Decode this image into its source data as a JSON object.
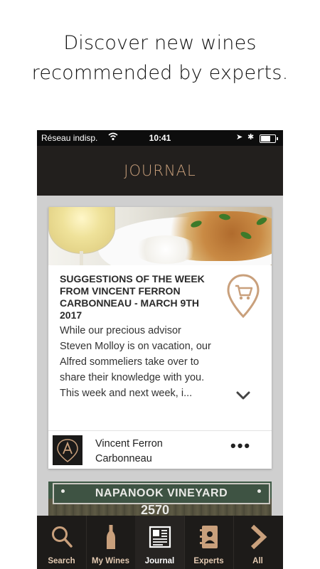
{
  "headline": "Discover new wines recommended by experts.",
  "status_bar": {
    "carrier": "Réseau indisp.",
    "time": "10:41"
  },
  "navbar": {
    "title": "JOURNAL"
  },
  "card": {
    "title": "SUGGESTIONS OF THE WEEK FROM VINCENT FERRON CARBONNEAU - MARCH 9TH 2017",
    "excerpt": "While our precious advisor Steven Molloy is on vacation, our Alfred sommeliers take over to share their knowledge with you. This week and next week, i...",
    "author": "Vincent Ferron Carbonneau",
    "more_label": "•••"
  },
  "card2": {
    "sign_text": "NAPANOOK VINEYARD",
    "number_text": "2570"
  },
  "tabs": [
    {
      "label": "Search",
      "icon": "search-icon"
    },
    {
      "label": "My Wines",
      "icon": "bottle-icon"
    },
    {
      "label": "Journal",
      "icon": "newspaper-icon"
    },
    {
      "label": "Experts",
      "icon": "contacts-book-icon"
    },
    {
      "label": "All",
      "icon": "chevron-right-icon"
    }
  ],
  "active_tab": "Journal",
  "colors": {
    "accent": "#c9a07c",
    "navbar_bg": "#221f1d",
    "tabbar_bg": "#1d1b19",
    "tab_label": "#e2c9b1"
  }
}
